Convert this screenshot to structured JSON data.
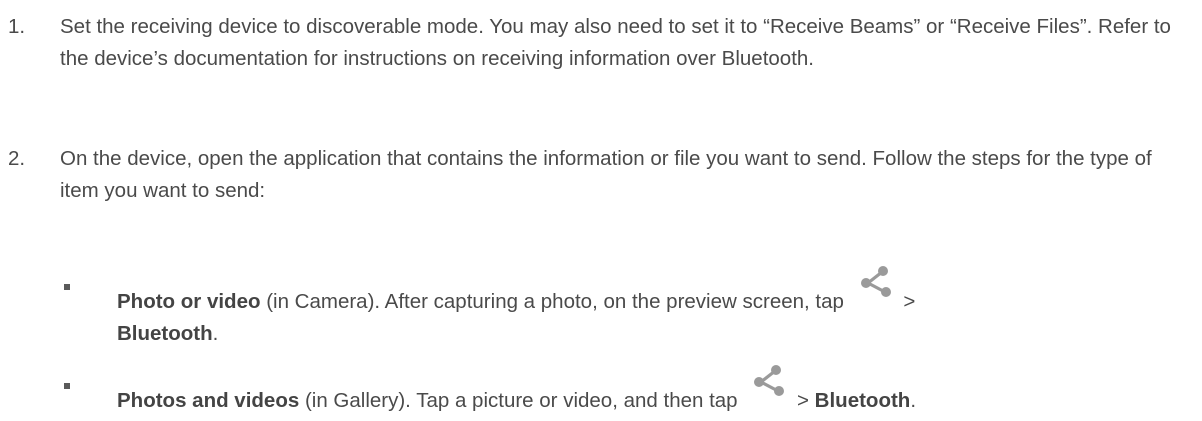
{
  "steps": [
    {
      "number": "1.",
      "text": "Set the receiving device to discoverable mode. You may also need to set it to “Receive Beams” or “Receive Files”. Refer to the device’s documentation for instructions on receiving information over Bluetooth."
    },
    {
      "number": "2.",
      "text": "On the device, open the application that contains the information or file you want to send. Follow the steps for the type of item you want to send:"
    }
  ],
  "bullets": [
    {
      "title": "Photo or video",
      "context": " (in Camera). After capturing a photo, on the preview screen, tap ",
      "separator": " > ",
      "target": "Bluetooth",
      "end": "."
    },
    {
      "title": "Photos and videos",
      "context": " (in Gallery). Tap a picture or video, and then tap ",
      "separator": " > ",
      "target": "Bluetooth",
      "end": "."
    }
  ],
  "icons": {
    "share": "share-icon",
    "bullet": "square-bullet-icon"
  },
  "colors": {
    "text": "#4a4a4a",
    "icon": "#9a9a9a"
  }
}
